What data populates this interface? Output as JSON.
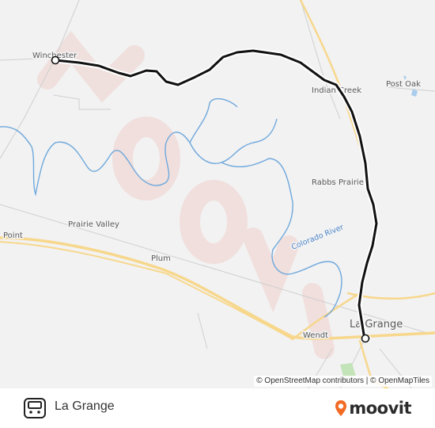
{
  "map": {
    "places": {
      "winchester": "Winchester",
      "post_oak": "Post Oak",
      "indian_creek": "Indian Creek",
      "rabbs_prairie": "Rabbs Prairie",
      "prairie_valley": "Prairie Valley",
      "point": "Point",
      "plum": "Plum",
      "la_grange": "La Grange",
      "wendt": "Wendt"
    },
    "river_label": "Colorado River",
    "watermark": "moovit",
    "colors": {
      "route": "#111111",
      "route_outline": "#ffffff",
      "river": "#6fa8dc",
      "highway": "#f7d78c",
      "water": "#a9cdee",
      "park": "#c3e3b8"
    }
  },
  "attribution": "© OpenStreetMap contributors | © OpenMapTiles",
  "footer": {
    "route_name": "La Grange",
    "brand": "moovit",
    "brand_color": "#f26a23",
    "icons": {
      "bus": "bus-icon",
      "brand": "moovit-pin-icon"
    }
  }
}
